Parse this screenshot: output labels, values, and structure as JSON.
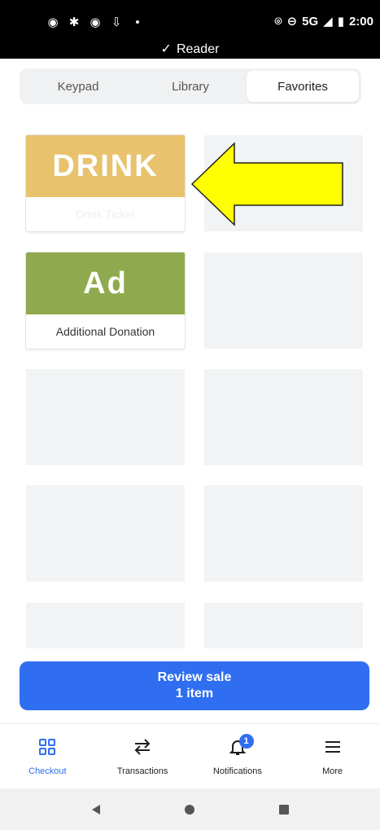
{
  "status_bar": {
    "left_icons": [
      "screen-record-icon",
      "bluetooth-icon",
      "screen-record-icon",
      "download-icon",
      "dot-icon"
    ],
    "network": "5G",
    "time": "2:00",
    "reader_label": "Reader"
  },
  "tabs": [
    {
      "label": "Keypad",
      "active": false
    },
    {
      "label": "Library",
      "active": false
    },
    {
      "label": "Favorites",
      "active": true
    }
  ],
  "favorites": [
    {
      "abbr": "DRINK",
      "name": "Drink Ticket",
      "color": "#e8c26c"
    },
    {
      "abbr": "Ad",
      "name": "Additional Donation",
      "color": "#8faa4e"
    }
  ],
  "review_button": {
    "line1": "Review sale",
    "line2": "1 item"
  },
  "bottom_nav": [
    {
      "label": "Checkout",
      "icon": "grid-icon",
      "active": true
    },
    {
      "label": "Transactions",
      "icon": "swap-arrows-icon",
      "active": false
    },
    {
      "label": "Notifications",
      "icon": "bell-icon",
      "active": false,
      "badge": "1"
    },
    {
      "label": "More",
      "icon": "hamburger-icon",
      "active": false
    }
  ],
  "colors": {
    "accent": "#2f6ef0",
    "arrow_fill": "#ffff00",
    "tile_empty": "#f2f3f4"
  }
}
